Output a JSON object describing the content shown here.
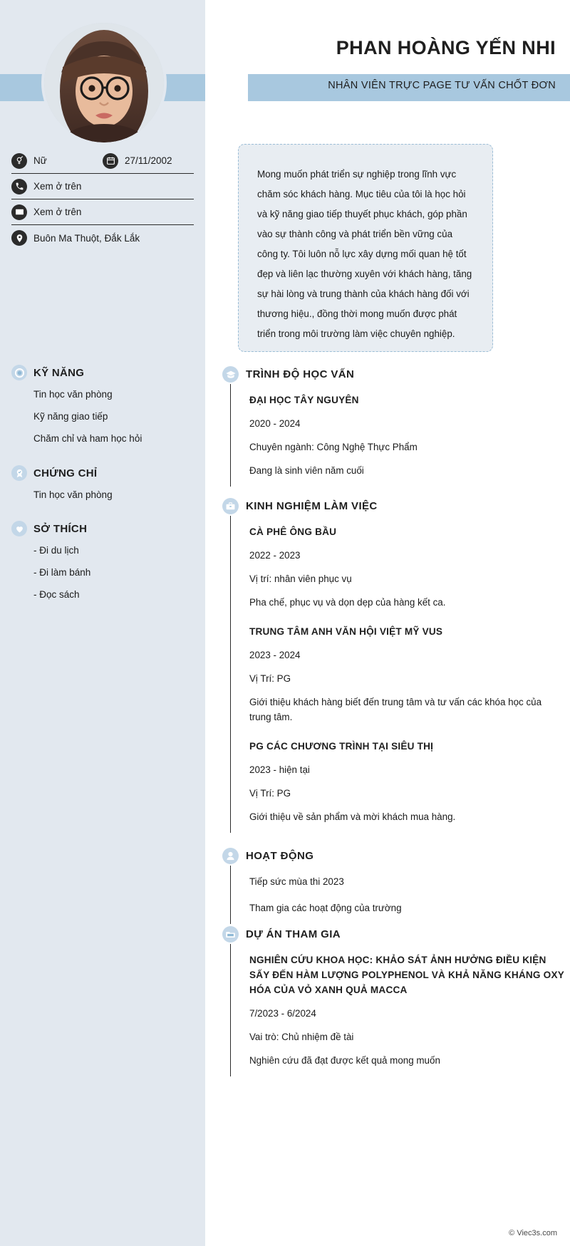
{
  "theme": {
    "sidebar_bg": "#e2e8ef",
    "band": "#a8c8df",
    "badge": "#c3d7e8",
    "summary_bg": "#e8edf2",
    "summary_border": "#9bbdd6",
    "text": "#1a1a1a"
  },
  "header": {
    "name": "PHAN HOÀNG YẾN NHI",
    "role": "NHÂN VIÊN TRỰC PAGE TƯ VẤN CHỐT ĐƠN",
    "photo_alt": "avatar"
  },
  "contacts": [
    {
      "icon": "gender-icon",
      "label": "Nữ"
    },
    {
      "icon": "calendar-icon",
      "label": "27/11/2002"
    },
    {
      "icon": "phone-icon",
      "label": "Xem ở trên"
    },
    {
      "icon": "email-icon",
      "label": "Xem ở trên"
    },
    {
      "icon": "location-icon",
      "label": "Buôn Ma Thuột, Đắk Lắk"
    }
  ],
  "sidebar": {
    "skills": {
      "icon": "target-icon",
      "title": "KỸ NĂNG",
      "items": [
        "Tin học văn phòng",
        "Kỹ năng giao tiếp",
        "Chăm chỉ và ham học hỏi"
      ]
    },
    "certificates": {
      "icon": "badge-award-icon",
      "title": "CHỨNG CHỈ",
      "items": [
        "Tin học văn phòng"
      ]
    },
    "hobbies": {
      "icon": "heart-icon",
      "title": "SỞ THÍCH",
      "items": [
        "- Đi du lịch",
        "- Đi làm bánh",
        "- Đọc sách"
      ]
    }
  },
  "summary": {
    "text": "Mong muốn phát triển sự nghiệp trong lĩnh vực chăm sóc khách hàng. Mục tiêu của tôi là học hỏi và kỹ năng giao tiếp thuyết phục khách, góp phần vào sự thành công và phát triển bền vững của công ty. Tôi luôn nỗ lực xây dựng mối quan hệ tốt đẹp và liên lạc thường xuyên với khách hàng, tăng sự hài lòng và trung thành của khách hàng đối với thương hiệu., đồng thời mong muốn được phát triển trong môi trường làm việc chuyên nghiệp."
  },
  "education": {
    "icon": "graduation-cap-icon",
    "title": "TRÌNH ĐỘ HỌC VẤN",
    "entries": [
      {
        "title": "ĐẠI HỌC TÂY NGUYÊN",
        "lines": [
          "2020 - 2024",
          "Chuyên ngành: Công Nghệ Thực Phẩm",
          "Đang là sinh viên năm cuối"
        ]
      }
    ]
  },
  "experience": {
    "icon": "briefcase-icon",
    "title": "KINH NGHIỆM LÀM VIỆC",
    "entries": [
      {
        "title": "CÀ PHÊ ÔNG BẦU",
        "lines": [
          "2022 - 2023",
          "Vị trí: nhân viên phục vụ",
          "Pha chế, phục vụ và dọn dẹp của hàng kết ca."
        ]
      },
      {
        "title": "TRUNG TÂM ANH VĂN HỘI VIỆT MỸ VUS",
        "lines": [
          "2023 - 2024",
          "Vị Trí: PG",
          "Giới thiệu khách hàng biết đến trung tâm và tư vấn các khóa học của trung tâm."
        ]
      },
      {
        "title": "PG CÁC CHƯƠNG TRÌNH TẠI SIÊU THỊ",
        "lines": [
          "2023 - hiện tại",
          "Vị Trí: PG",
          "Giới thiệu về sản phẩm và mời khách mua hàng."
        ]
      }
    ]
  },
  "activities": {
    "icon": "activity-icon",
    "title": "HOẠT ĐỘNG",
    "lines": [
      "Tiếp sức mùa thi 2023",
      "Tham gia các hoạt động của trường"
    ]
  },
  "projects": {
    "icon": "project-folder-icon",
    "title": "DỰ ÁN THAM GIA",
    "entries": [
      {
        "title": "NGHIÊN CỨU KHOA HỌC: KHẢO SÁT ẢNH HƯỞNG ĐIỀU KIỆN SẤY ĐẾN HÀM LƯỢNG POLYPHENOL VÀ KHẢ NĂNG KHÁNG OXY HÓA CỦA VỎ XANH QUẢ MACCA",
        "lines": [
          "7/2023 - 6/2024",
          "Vai trò: Chủ nhiệm đề tài",
          "Nghiên cứu đã đạt được kết quả mong muốn"
        ]
      }
    ]
  },
  "footer": {
    "credit": "© Viec3s.com"
  }
}
